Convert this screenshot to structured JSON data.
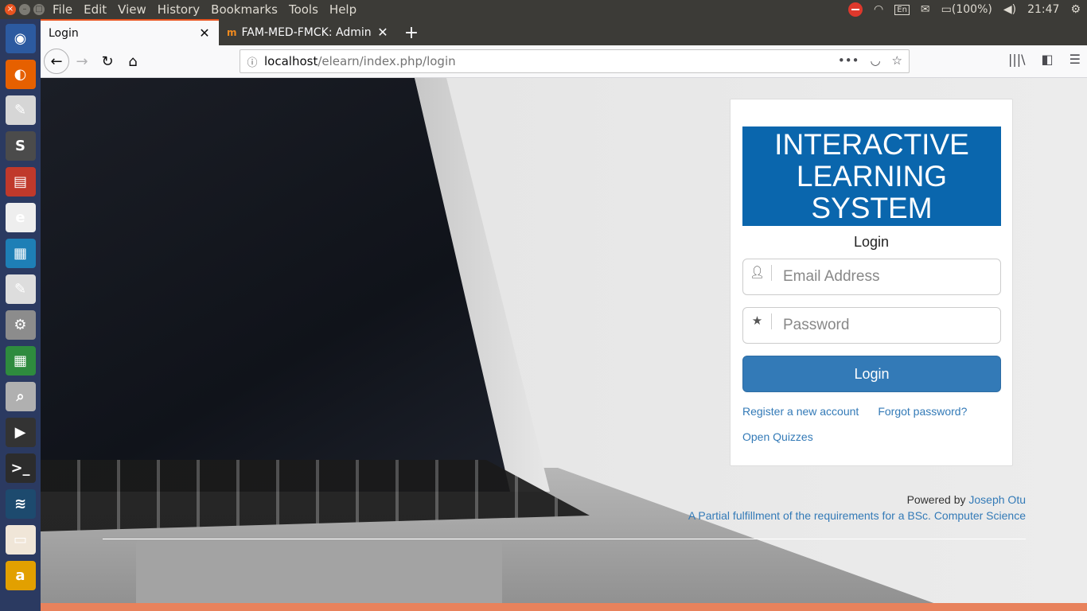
{
  "topbar": {
    "menus": [
      "File",
      "Edit",
      "View",
      "History",
      "Bookmarks",
      "Tools",
      "Help"
    ],
    "keyboard_layout": "En",
    "battery": "(100%)",
    "clock": "21:47"
  },
  "launcher": {
    "apps": [
      {
        "name": "ubuntu-dash-icon",
        "color": "#2c5aa0",
        "glyph": "◉"
      },
      {
        "name": "firefox-icon",
        "color": "#e66000",
        "glyph": "◐"
      },
      {
        "name": "text-editor-icon",
        "color": "#d6d6d6",
        "glyph": "✎"
      },
      {
        "name": "sublime-text-icon",
        "color": "#4b4b4b",
        "glyph": "S"
      },
      {
        "name": "files-icon",
        "color": "#c0392b",
        "glyph": "▤"
      },
      {
        "name": "app-e-icon",
        "color": "#eeeeee",
        "glyph": "e"
      },
      {
        "name": "impress-icon",
        "color": "#1e7fb6",
        "glyph": "▦"
      },
      {
        "name": "writer-icon",
        "color": "#dddddd",
        "glyph": "✎"
      },
      {
        "name": "settings-icon",
        "color": "#8c8c8c",
        "glyph": "⚙"
      },
      {
        "name": "calc-icon",
        "color": "#2e8b3e",
        "glyph": "▦"
      },
      {
        "name": "image-viewer-icon",
        "color": "#b0b0b0",
        "glyph": "⌕"
      },
      {
        "name": "video-editor-icon",
        "color": "#333333",
        "glyph": "▶"
      },
      {
        "name": "terminal-icon",
        "color": "#2c2c2c",
        "glyph": ">_"
      },
      {
        "name": "mysql-workbench-icon",
        "color": "#1d4a6e",
        "glyph": "≋"
      },
      {
        "name": "presentation-icon",
        "color": "#f0e6d8",
        "glyph": "▭"
      },
      {
        "name": "amazon-icon",
        "color": "#e2a000",
        "glyph": "a"
      }
    ]
  },
  "tabs": [
    {
      "label": "Login",
      "active": true
    },
    {
      "label": "FAM-MED-FMCK: Admin",
      "active": false
    }
  ],
  "urlbar": {
    "host": "localhost",
    "path": "/elearn/index.php/login"
  },
  "login": {
    "brand_lines": [
      "INTERACTIVE",
      "LEARNING",
      "SYSTEM"
    ],
    "title": "Login",
    "email_placeholder": "Email Address",
    "password_placeholder": "Password",
    "submit_label": "Login",
    "register_link": "Register a new account",
    "forgot_link": "Forgot password?",
    "quizzes_link": "Open Quizzes"
  },
  "footer": {
    "powered_prefix": "Powered by",
    "author": "Joseph Otu",
    "note": "A Partial fulfillment of the requirements for a BSc. Computer Science"
  },
  "colors": {
    "brand": "#0a66ad",
    "button": "#337ab7",
    "link": "#337ab7"
  }
}
